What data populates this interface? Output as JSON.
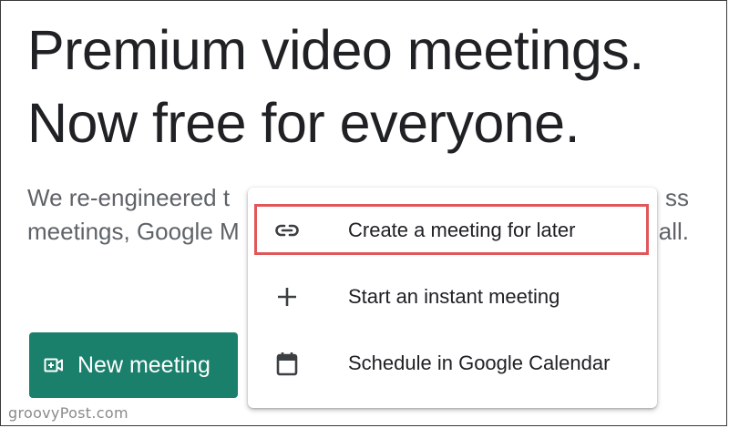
{
  "headline": {
    "line1": "Premium video meetings.",
    "line2": "Now free for everyone."
  },
  "subtext": {
    "line1_left": "We re-engineered t",
    "line2_left": "meetings, Google M",
    "line1_right": "ss",
    "line2_right": "all."
  },
  "new_meeting_button": {
    "label": "New meeting",
    "icon": "video-plus-icon",
    "color": "#1a7f6b"
  },
  "menu": {
    "items": [
      {
        "label": "Create a meeting for later",
        "icon": "link-icon",
        "highlighted": true
      },
      {
        "label": "Start an instant meeting",
        "icon": "plus-icon",
        "highlighted": false
      },
      {
        "label": "Schedule in Google Calendar",
        "icon": "calendar-icon",
        "highlighted": false
      }
    ],
    "highlight_color": "#e0575a"
  },
  "watermark": "groovyPost.com"
}
